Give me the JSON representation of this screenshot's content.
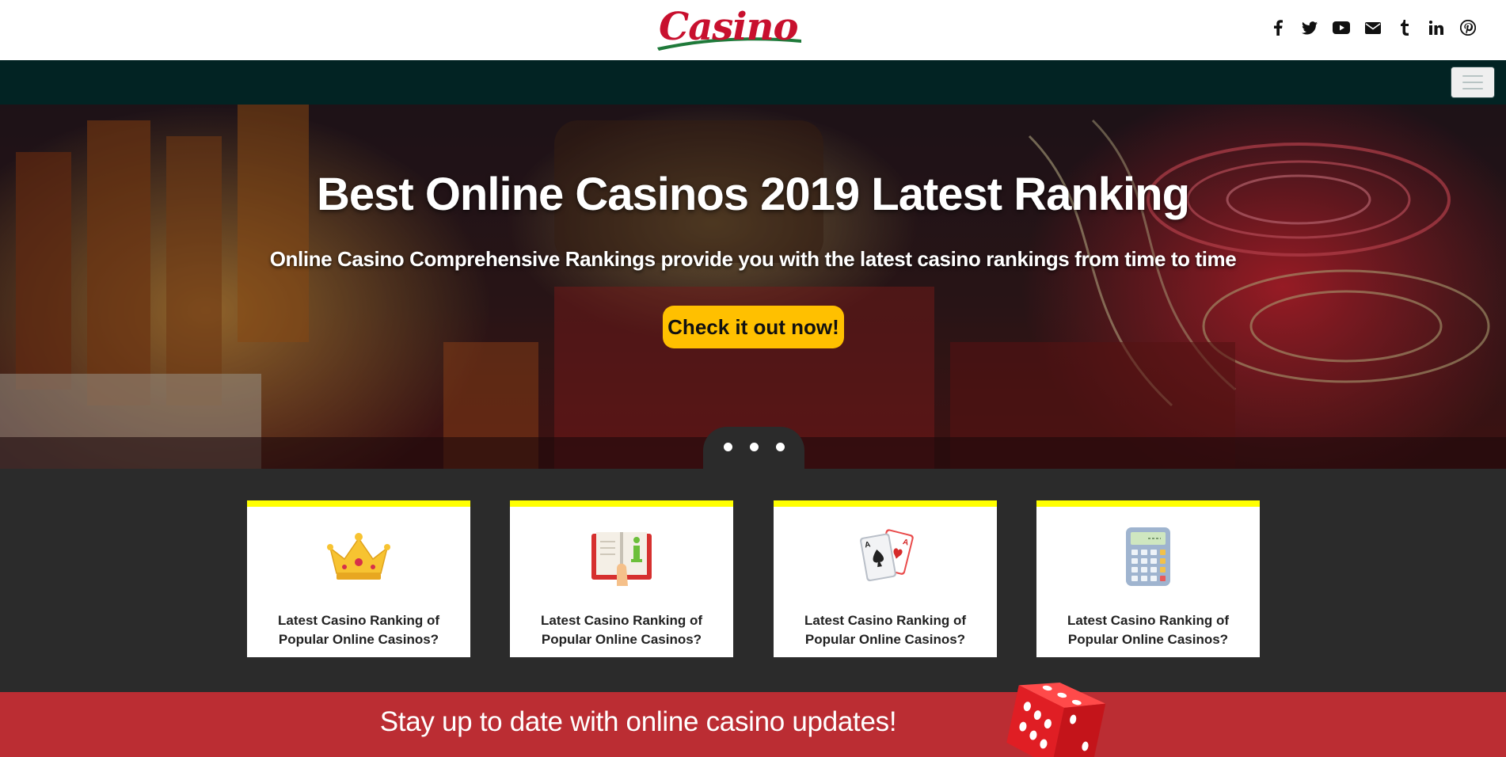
{
  "header": {
    "logo_text": "Casino",
    "social_icons": [
      "facebook-icon",
      "twitter-icon",
      "youtube-icon",
      "envelope-icon",
      "tumblr-icon",
      "linkedin-icon",
      "pinterest-icon"
    ]
  },
  "nav": {
    "menu_icon": "hamburger-icon"
  },
  "hero": {
    "title": "Best Online Casinos 2019 Latest Ranking",
    "subtitle": "Online Casino Comprehensive Rankings provide you with the latest casino rankings from time to time",
    "cta_label": "Check it out now!",
    "carousel_dots": 3
  },
  "cards": [
    {
      "icon": "crown-icon",
      "title": "Latest Casino Ranking of Popular Online Casinos?"
    },
    {
      "icon": "book-info-icon",
      "title": "Latest Casino Ranking of Popular Online Casinos?"
    },
    {
      "icon": "playing-cards-icon",
      "title": "Latest Casino Ranking of Popular Online Casinos?"
    },
    {
      "icon": "calculator-icon",
      "title": "Latest Casino Ranking of Popular Online Casinos?"
    }
  ],
  "banner": {
    "text": "Stay up to date with online casino updates!"
  },
  "colors": {
    "brand_red": "#c8102e",
    "nav_bg": "#022323",
    "cta_yellow": "#ffc000",
    "card_accent": "#ffff00",
    "banner_red": "#bb2d33",
    "section_bg": "#2b2b2b"
  }
}
